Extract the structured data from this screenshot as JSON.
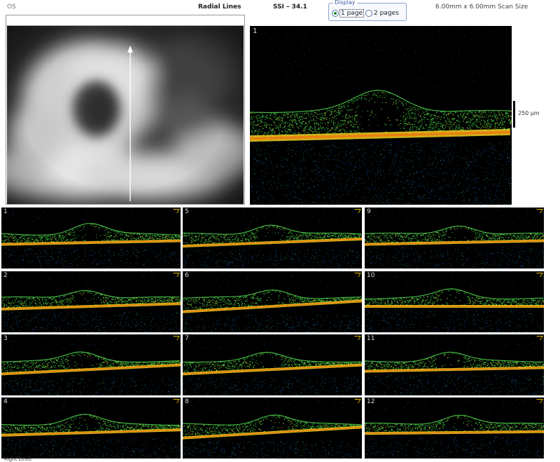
{
  "header": {
    "left_label": "OS",
    "scan_type": "Radial Lines",
    "ssi": "SSI – 34.1",
    "scan_size": "6.00mm x 6.00mm Scan Size"
  },
  "display": {
    "legend": "Display",
    "option1": "1 page",
    "option2": "2 pages",
    "selected": "1 page"
  },
  "main_scan": {
    "number": "1"
  },
  "scale": {
    "label": "250 µm"
  },
  "thumbnails": [
    {
      "number": "1"
    },
    {
      "number": "2"
    },
    {
      "number": "3"
    },
    {
      "number": "4"
    },
    {
      "number": "5"
    },
    {
      "number": "6"
    },
    {
      "number": "7"
    },
    {
      "number": "8"
    },
    {
      "number": "9"
    },
    {
      "number": "10"
    },
    {
      "number": "11"
    },
    {
      "number": "12"
    }
  ],
  "footer": {
    "label": "Right Lines"
  },
  "colors": {
    "scan_background": "#000000",
    "retina_green": "#3fd24a",
    "rpe_yellow": "#f0d020",
    "rpe_orange": "#f07a10",
    "noise_blue": "#1a5fa8"
  }
}
